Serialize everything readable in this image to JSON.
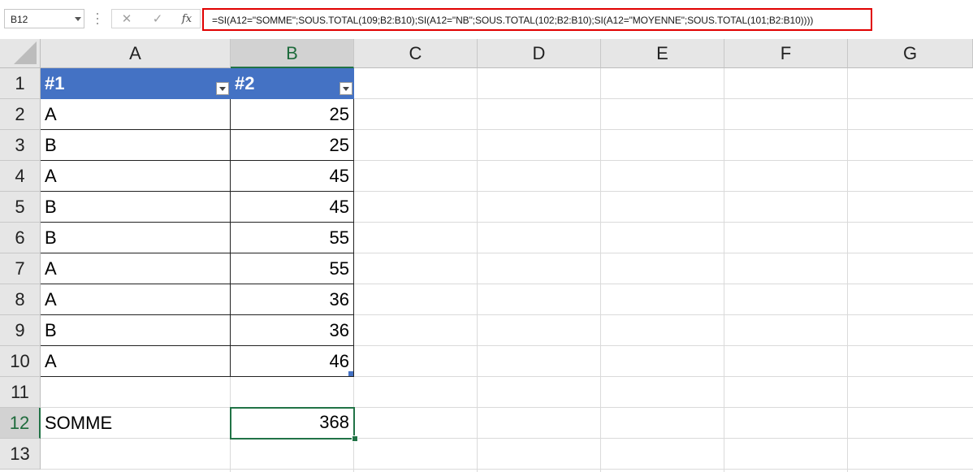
{
  "formula_bar": {
    "name_box": "B12",
    "cancel_icon": "close-icon",
    "enter_icon": "check-icon",
    "fx_label": "fx",
    "formula": "=SI(A12=\"SOMME\";SOUS.TOTAL(109;B2:B10);SI(A12=\"NB\";SOUS.TOTAL(102;B2:B10);SI(A12=\"MOYENNE\";SOUS.TOTAL(101;B2:B10))))",
    "highlight_color": "#e00000"
  },
  "columns": [
    "A",
    "B",
    "C",
    "D",
    "E",
    "F",
    "G"
  ],
  "rows": [
    "1",
    "2",
    "3",
    "4",
    "5",
    "6",
    "7",
    "8",
    "9",
    "10",
    "11",
    "12",
    "13"
  ],
  "table": {
    "header_color": "#4472c4",
    "headers": [
      "#1",
      "#2"
    ],
    "rows": [
      [
        "A",
        "25"
      ],
      [
        "B",
        "25"
      ],
      [
        "A",
        "45"
      ],
      [
        "B",
        "45"
      ],
      [
        "B",
        "55"
      ],
      [
        "A",
        "55"
      ],
      [
        "A",
        "36"
      ],
      [
        "B",
        "36"
      ],
      [
        "A",
        "46"
      ]
    ]
  },
  "row12": {
    "label": "SOMME",
    "value": "368"
  },
  "selection": {
    "cell": "B12",
    "color": "#217346"
  }
}
